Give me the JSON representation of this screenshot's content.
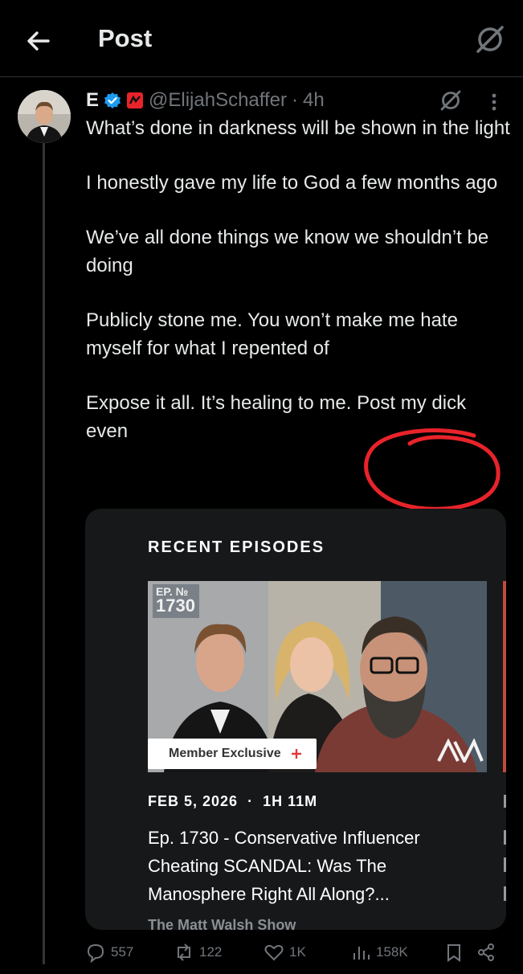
{
  "header": {
    "title": "Post"
  },
  "post": {
    "author": {
      "display_name": "E",
      "handle": "@ElijahSchaffer",
      "time_sep": "·",
      "time": "4h"
    },
    "paragraphs": [
      "What’s done in darkness will be shown in the light",
      "I honestly gave my life to God a few months ago",
      "We’ve all done things we know we shouldn’t be doing",
      "Publicly stone me. You won’t make me hate myself for what I repented of",
      "Expose it all. It’s healing to me. Post my dick even"
    ],
    "annotation_color": "#e8232a"
  },
  "card": {
    "heading": "RECENT EPISODES",
    "thumb": {
      "ep_label_top": "EP. №",
      "ep_label_num": "1730",
      "badge": "Member Exclusive",
      "badge_accent": "#e03a3a"
    },
    "date": "FEB 5, 2026",
    "meta_sep": "·",
    "duration": "1H 11M",
    "title": "Ep. 1730 - Conservative Influencer Cheating SCANDAL: Was The Manosphere Right All Along?...",
    "show": "The Matt Walsh Show"
  },
  "actions": {
    "replies": "557",
    "reposts": "122",
    "likes": "1K",
    "views": "158K"
  }
}
